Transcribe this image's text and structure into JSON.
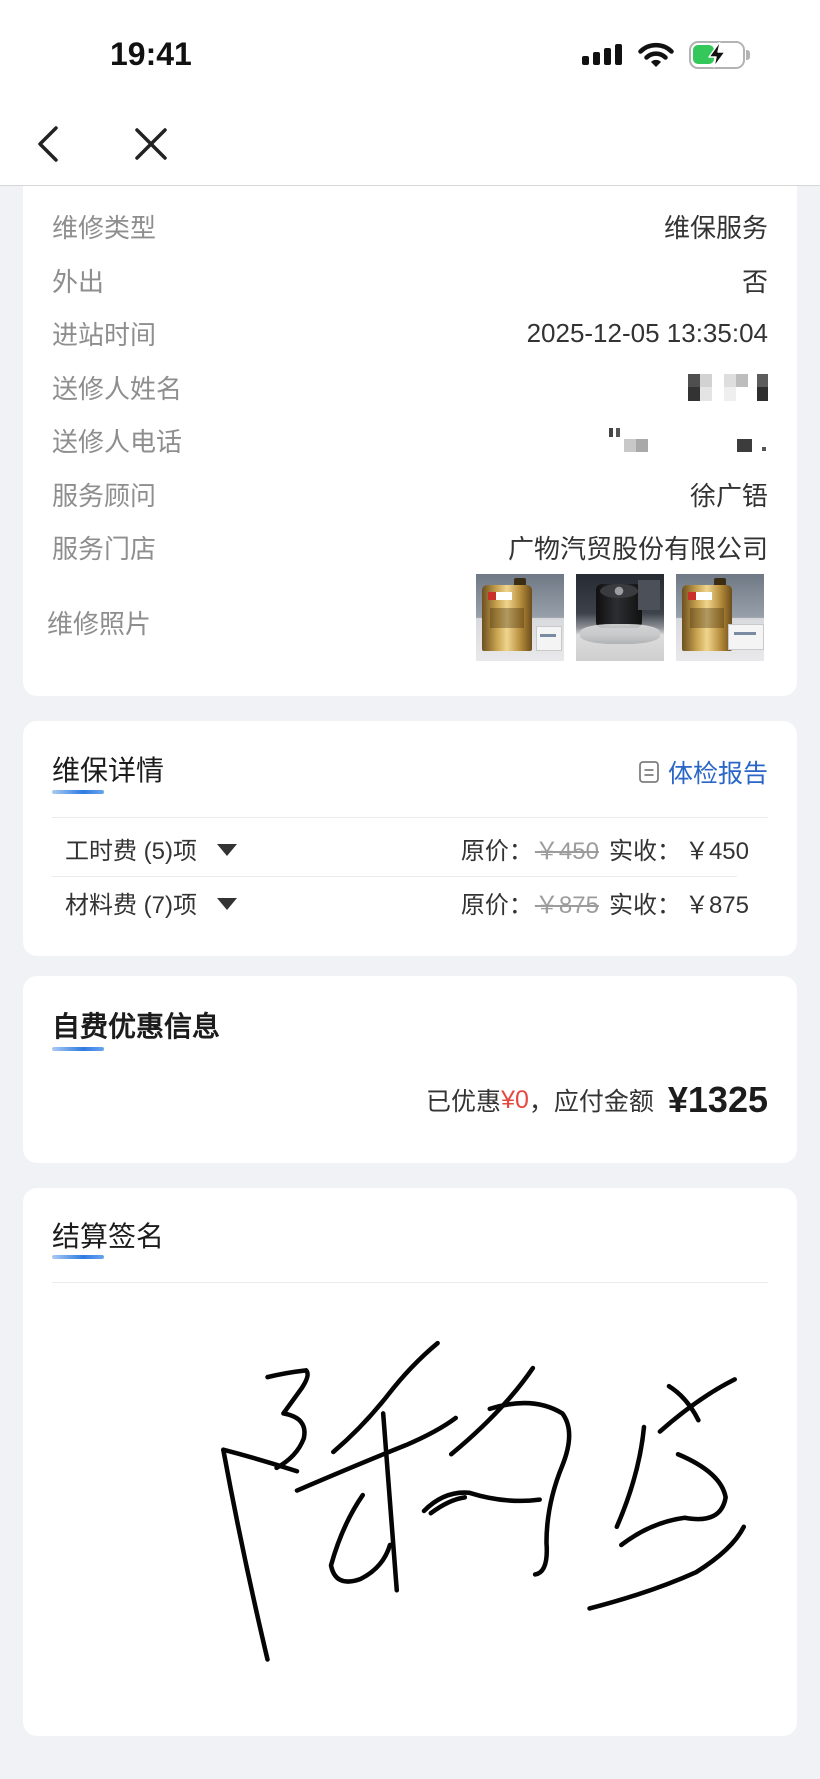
{
  "status_bar": {
    "time": "19:41",
    "signal_bars": 4,
    "battery_level": 0.45,
    "charging": true
  },
  "nav": {
    "back_icon": "chevron-left-icon",
    "close_icon": "close-icon"
  },
  "info_card": {
    "rows": [
      {
        "label": "维修类型",
        "value": "维保服务"
      },
      {
        "label": "外出",
        "value": "否"
      },
      {
        "label": "进站时间",
        "value": "2025-12-05 13:35:04"
      },
      {
        "label": "送修人姓名",
        "value": ""
      },
      {
        "label": "送修人电话",
        "value": ""
      },
      {
        "label": "服务顾问",
        "value": "徐广铻"
      },
      {
        "label": "服务门店",
        "value": "广物汽贸股份有限公司"
      }
    ],
    "photos_label": "维修照片"
  },
  "maintenance": {
    "title": "维保详情",
    "report_link": "体检报告",
    "report_icon": "document-icon",
    "items": [
      {
        "name": "工时费 (5)项",
        "original_label": "原价：",
        "original_price": "￥450",
        "actual_label": "实收：",
        "actual_price": "￥450"
      },
      {
        "name": "材料费 (7)项",
        "original_label": "原价：",
        "original_price": "￥875",
        "actual_label": "实收：",
        "actual_price": "￥875"
      }
    ]
  },
  "discount": {
    "title": "自费优惠信息",
    "discounted_label": "已优惠",
    "discounted_amount": "¥0",
    "payable_label": "，应付金额",
    "payable_amount": "¥1325"
  },
  "signature": {
    "title": "结算签名"
  },
  "colors": {
    "accent": "#2a66c8",
    "discount": "#e8483f",
    "battery": "#34c759",
    "page_background": "#f1f2f6"
  }
}
